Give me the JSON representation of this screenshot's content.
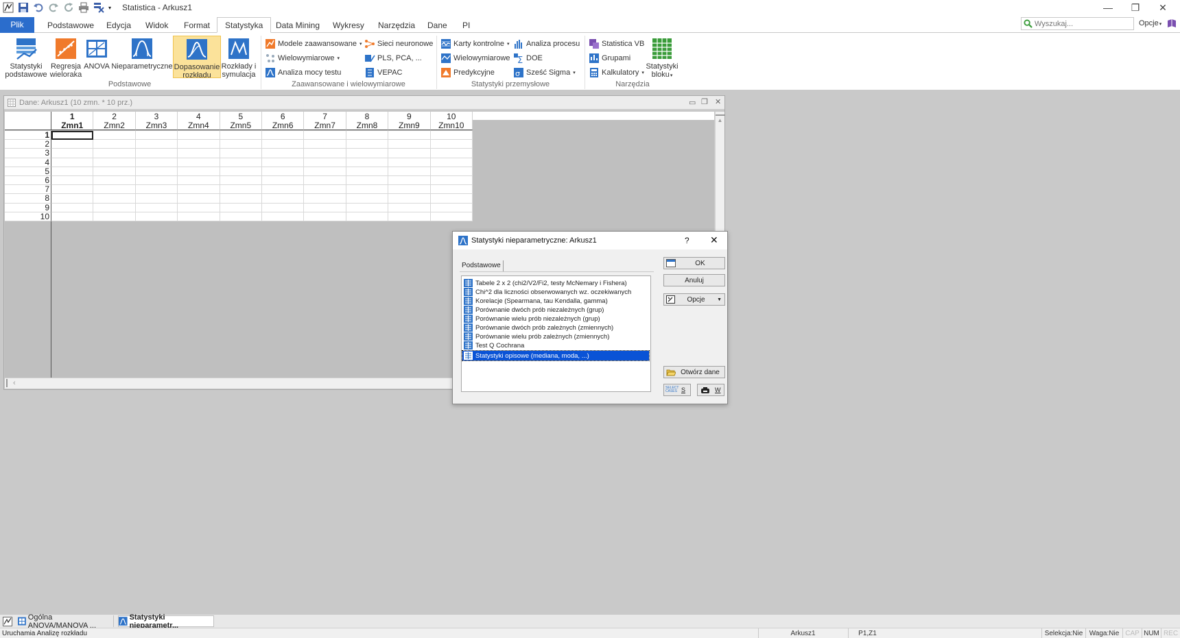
{
  "app": {
    "title": "Statistica - Arkusz1"
  },
  "tabs": [
    {
      "label": "Plik"
    },
    {
      "label": "Podstawowe"
    },
    {
      "label": "Edycja"
    },
    {
      "label": "Widok"
    },
    {
      "label": "Format"
    },
    {
      "label": "Statystyka"
    },
    {
      "label": "Data Mining"
    },
    {
      "label": "Wykresy"
    },
    {
      "label": "Narzędzia"
    },
    {
      "label": "Dane"
    },
    {
      "label": "PI"
    }
  ],
  "search": {
    "placeholder": "Wyszukaj..."
  },
  "top_options": "Opcje",
  "ribbon": {
    "podstawowe": {
      "label": "Podstawowe",
      "buttons": [
        {
          "line1": "Statystyki",
          "line2": "podstawowe"
        },
        {
          "line1": "Regresja",
          "line2": "wieloraka"
        },
        {
          "line1": "ANOVA",
          "line2": ""
        },
        {
          "line1": "Nieparametryczne",
          "line2": ""
        },
        {
          "line1": "Dopasowanie",
          "line2": "rozkładu"
        },
        {
          "line1": "Rozkłady i",
          "line2": "symulacja"
        }
      ]
    },
    "zaawansowane": {
      "label": "Zaawansowane i wielowymiarowe",
      "items": [
        "Modele zaawansowane",
        "Wielowymiarowe",
        "Analiza mocy testu",
        "Sieci neuronowe",
        "PLS, PCA, ...",
        "VEPAC"
      ]
    },
    "przemyslowe": {
      "label": "Statystyki przemysłowe",
      "items": [
        "Karty kontrolne",
        "Wielowymiarowe",
        "Predykcyjne",
        "Analiza procesu",
        "DOE",
        "Sześć Sigma"
      ]
    },
    "narzedzia": {
      "label": "Narzędzia",
      "items": [
        "Statistica VB",
        "Grupami",
        "Kalkulatory"
      ],
      "big": {
        "line1": "Statystyki",
        "line2": "bloku"
      }
    }
  },
  "data_window": {
    "title": "Dane: Arkusz1 (10 zmn. * 10 prz.)",
    "columns": [
      {
        "num": "1",
        "name": "Zmn1"
      },
      {
        "num": "2",
        "name": "Zmn2"
      },
      {
        "num": "3",
        "name": "Zmn3"
      },
      {
        "num": "4",
        "name": "Zmn4"
      },
      {
        "num": "5",
        "name": "Zmn5"
      },
      {
        "num": "6",
        "name": "Zmn6"
      },
      {
        "num": "7",
        "name": "Zmn7"
      },
      {
        "num": "8",
        "name": "Zmn8"
      },
      {
        "num": "9",
        "name": "Zmn9"
      },
      {
        "num": "10",
        "name": "Zmn10"
      }
    ],
    "rows": [
      "1",
      "2",
      "3",
      "4",
      "5",
      "6",
      "7",
      "8",
      "9",
      "10"
    ]
  },
  "dialog": {
    "title": "Statystyki nieparametryczne: Arkusz1",
    "help": "?",
    "tab": "Podstawowe",
    "list": [
      "Tabele 2 x 2 (chi2/V2/Fi2, testy McNemary i Fishera)",
      "Chi^2 dla liczności obserwowanych wz. oczekiwanych",
      "Korelacje (Spearmana, tau Kendalla, gamma)",
      "Porównanie dwóch prób niezależnych (grup)",
      "Porównanie wielu prób niezależnych (grup)",
      "Porównanie dwóch prób zależnych (zmiennych)",
      "Porównanie wielu prób zależnych (zmiennych)",
      "Test Q Cochrana",
      "Statystyki opisowe (mediana, moda, ...)"
    ],
    "selected_index": 8,
    "buttons": {
      "ok": "OK",
      "cancel": "Anuluj",
      "options": "Opcje",
      "open_data": "Otwórz dane",
      "select_cases_label": "SELECT CASES",
      "s": "S",
      "w": "W"
    }
  },
  "taskbar": [
    {
      "label": "Ogólna ANOVA/MANOVA ..."
    },
    {
      "label": "Statystyki nieparametr..."
    }
  ],
  "status": {
    "message": "Uruchamia Analizę rozkładu",
    "sheet": "Arkusz1",
    "pos": "P1,Z1",
    "selection": "Selekcja:Nie",
    "weight": "Waga:Nie",
    "cap": "CAP",
    "num": "NUM",
    "rec": "REC"
  }
}
